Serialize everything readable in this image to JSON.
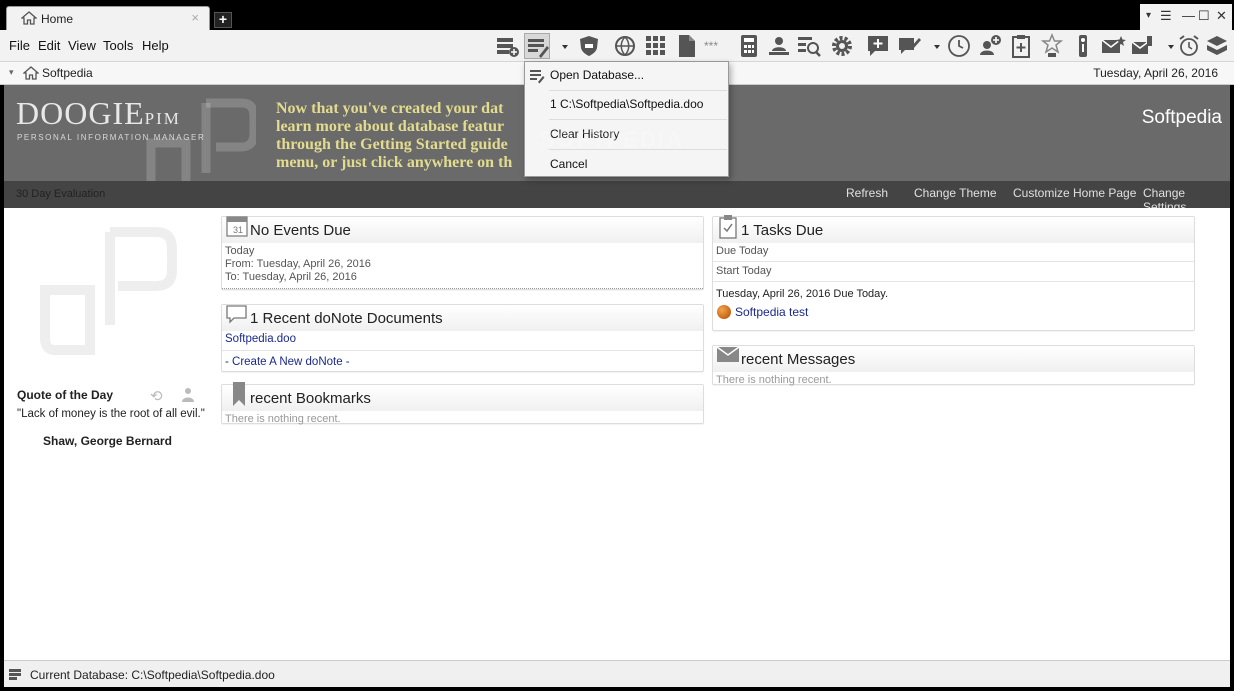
{
  "tab": {
    "label": "Home",
    "close": "×",
    "new_tab": "+"
  },
  "window": {
    "min": "—",
    "max": "☐",
    "close": "✕",
    "menu": "☰",
    "arrow": "▾"
  },
  "menu": {
    "file": "File",
    "edit": "Edit",
    "view": "View",
    "tools": "Tools",
    "help": "Help"
  },
  "address": {
    "label": "Softpedia",
    "date": "Tuesday, April 26, 2016"
  },
  "banner": {
    "brand": "DOOGIE",
    "brand_suffix": "PIM",
    "brand_sub": "PERSONAL INFORMATION MANAGER",
    "message": "Now that you've created your dat learn more about database featur through the Getting Started guide menu, or just click anywhere on th",
    "user": "Softpedia",
    "evaluation": "30 Day Evaluation",
    "links": {
      "refresh": "Refresh",
      "theme": "Change Theme",
      "customize": "Customize Home Page",
      "settings": "Change Settings"
    }
  },
  "events": {
    "title": "No Events Due",
    "calendar_day": "31",
    "today": "Today",
    "from": "From: Tuesday, April 26, 2016",
    "to": "To: Tuesday, April 26, 2016"
  },
  "donote": {
    "title": "1 Recent doNote Documents",
    "doc": "Softpedia.doo",
    "create": "- Create A New doNote -"
  },
  "bookmarks": {
    "title": "recent Bookmarks",
    "empty": "There is nothing recent."
  },
  "tasks": {
    "title": "1 Tasks Due",
    "due_today": "Due Today",
    "start_today": "Start Today",
    "summary": "Tuesday, April 26, 2016 Due Today.",
    "task": "Softpedia test"
  },
  "messages": {
    "title": "recent Messages",
    "empty": "There is nothing recent."
  },
  "quote": {
    "title": "Quote of the Day",
    "text": "\"Lack of money is the root of all evil.\"",
    "author": "Shaw, George Bernard"
  },
  "status": {
    "text": "Current Database: C:\\Softpedia\\Softpedia.doo"
  },
  "dropdown": {
    "open": "Open Database...",
    "recent": "1 C:\\Softpedia\\Softpedia.doo",
    "clear": "Clear History",
    "cancel": "Cancel"
  },
  "watermark": "SOFTPEDIA",
  "toolbar_extra": "***",
  "colors": {
    "accent_text": "#e3dc8e",
    "banner": "#6a6a6a",
    "link": "#1a2a8a"
  }
}
